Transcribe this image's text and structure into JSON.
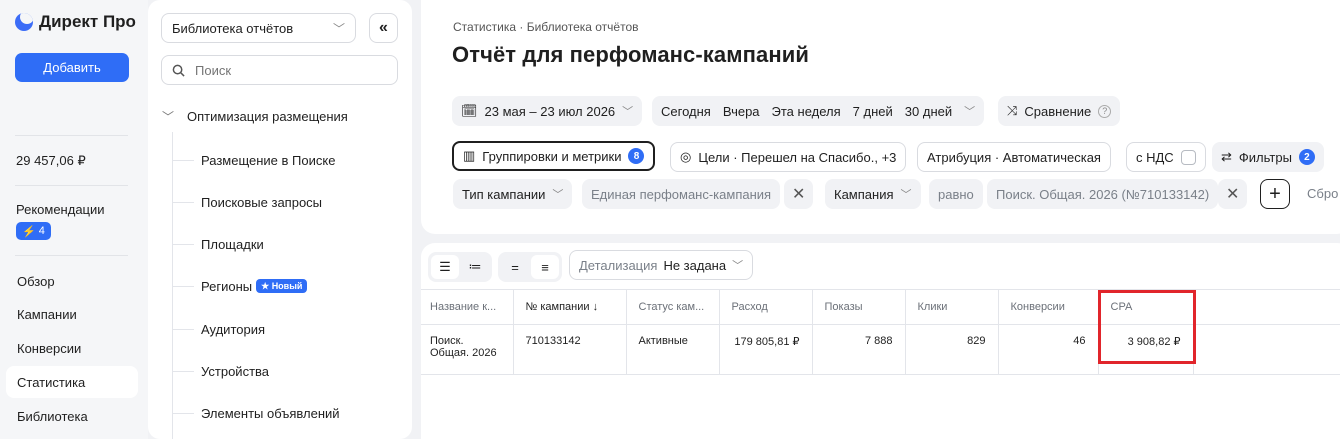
{
  "app": {
    "logo_text": "Директ Про",
    "add_button": "Добавить",
    "balance": "29 457,06 ₽",
    "recommendations_label": "Рекомендации",
    "recommendations_count": "4",
    "nav": [
      "Обзор",
      "Кампании",
      "Конверсии",
      "Статистика",
      "Библиотека"
    ],
    "active_nav": "Статистика"
  },
  "library": {
    "select_value": "Библиотека отчётов",
    "search_placeholder": "Поиск",
    "group_label": "Оптимизация размещения",
    "items": [
      "Размещение в Поиске",
      "Поисковые запросы",
      "Площадки",
      "Регионы",
      "Аудитория",
      "Устройства",
      "Элементы объявлений"
    ],
    "new_badge": "Новый"
  },
  "header": {
    "breadcrumb": "Статистика · Библиотека отчётов",
    "title": "Отчёт для перфоманс-кампаний",
    "date_range": "23 мая – 23 июл 2026",
    "quick_periods": [
      "Сегодня",
      "Вчера",
      "Эта неделя",
      "7 дней",
      "30 дней"
    ],
    "comparison": "Сравнение",
    "groupings": "Группировки и метрики",
    "groupings_count": "8",
    "goals": "Цели · Перешел на Спасибо., +3",
    "attribution": "Атрибуция · Автоматическая",
    "vat": "с НДС",
    "filters": "Фильтры",
    "filters_count": "2",
    "filter1_field": "Тип кампании",
    "filter1_value": "Единая перфоманс-кампания",
    "filter2_field": "Кампания",
    "filter2_op": "равно",
    "filter2_value": "Поиск. Общая. 2026 (№710133142)",
    "reset": "Сбро"
  },
  "table": {
    "detail_label": "Детализация",
    "detail_value": "Не задана",
    "columns": [
      "Название к...",
      "№ кампании ↓",
      "Статус кам...",
      "Расход",
      "Показы",
      "Клики",
      "Конверсии",
      "CPA"
    ],
    "rows": [
      {
        "name_line1": "Поиск.",
        "name_line2": "Общая. 2026",
        "campaign_id": "710133142",
        "status": "Активные",
        "cost": "179 805,81 ₽",
        "impressions": "7 888",
        "clicks": "829",
        "conversions": "46",
        "cpa": "3 908,82 ₽"
      }
    ]
  },
  "colors": {
    "accent": "#2f6df6",
    "highlight": "#e1252b",
    "background": "#f1f2f5"
  }
}
